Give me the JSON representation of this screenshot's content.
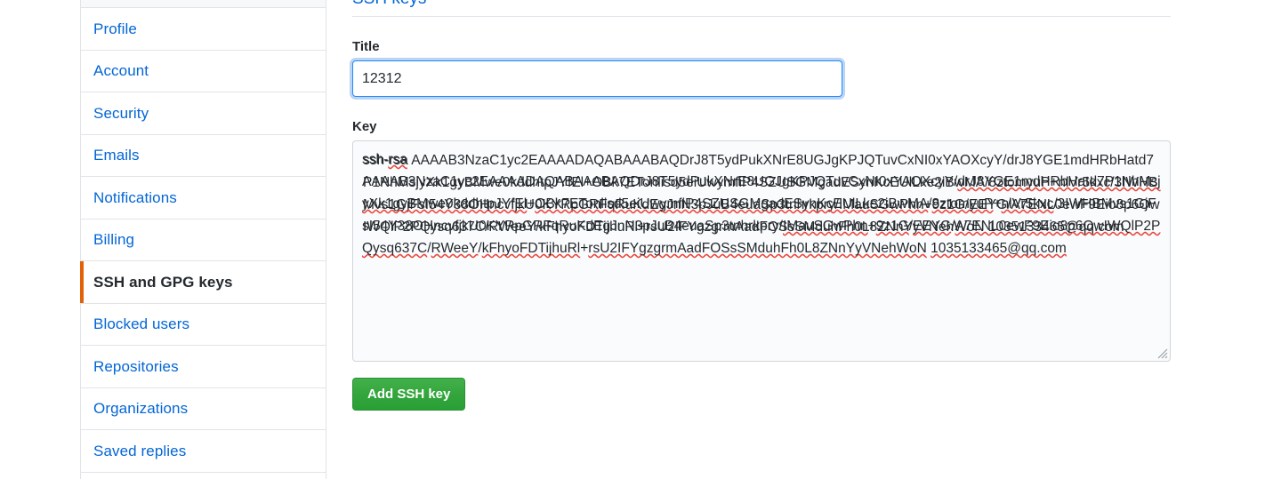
{
  "sidebar": {
    "items": [
      {
        "label": "Profile",
        "name": "profile",
        "selected": false
      },
      {
        "label": "Account",
        "name": "account",
        "selected": false
      },
      {
        "label": "Security",
        "name": "security",
        "selected": false
      },
      {
        "label": "Emails",
        "name": "emails",
        "selected": false
      },
      {
        "label": "Notifications",
        "name": "notifications",
        "selected": false
      },
      {
        "label": "Billing",
        "name": "billing",
        "selected": false
      },
      {
        "label": "SSH and GPG keys",
        "name": "ssh-and-gpg-keys",
        "selected": true
      },
      {
        "label": "Blocked users",
        "name": "blocked-users",
        "selected": false
      },
      {
        "label": "Repositories",
        "name": "repositories",
        "selected": false
      },
      {
        "label": "Organizations",
        "name": "organizations",
        "selected": false
      },
      {
        "label": "Saved replies",
        "name": "saved-replies",
        "selected": false
      }
    ],
    "accent_color": "#e36209",
    "link_color": "#0366d6"
  },
  "main": {
    "heading": "SSH keys",
    "title_field": {
      "label": "Title",
      "value": "12312",
      "placeholder": ""
    },
    "key_field": {
      "label": "Key",
      "placeholder": "",
      "value": "ssh-rsa AAAAB3NzaC1yc2EAAAADAQABAAABAQDrJ8T5ydPukXNrE8UGJgKPJQTuvCxNI0xYAOXcyY/drJ8YGE1mdHRbHatd7P1NhMsjyXk1gyBMwe0kddhtpJYfEl+OBk7ETonlisd5eiUwymfiP4SZUSGMgadESynKcEUlLke2iBwMA/8ztomyuP+nlVr5kxc/3IWHBMvs1GjFsI54Y38OHncvfjkU0KYRpGRFqRuKdEgJnN3pJuB4euaSp3tnhrkpry/IMauSGwPhn+9z1G/EEYG/A7ENL0ewF9Eio8p6OwIWQlP2PQysq637C/RWeeY/kFhyoFDTijhuRl+rsU2IFYgzgrmAadFOSsSMduhFh0L8ZNnYyVNehWoN 1035133465@qq.com",
      "segments": [
        {
          "text": "ssh-",
          "spell": false
        },
        {
          "text": "rsa",
          "spell": true
        },
        {
          "text": "\nAAAAB3NzaC1yc2EAAAADAQABAAABAQDrJ8T5ydPukXNrE8UGJgKPJQTuvCxNI0xYAOXcyY/",
          "spell": false
        },
        {
          "text": "drJ8YGE1mdHRbHatd7P1NhMsjyXk1gyBMwe0kddhtpJYfEl",
          "spell": true
        },
        {
          "text": "+",
          "spell": false
        },
        {
          "text": "OBk7ETonlisd5eiUwymfiP4SZUSGMgadESynKcEUlLke2iBwMA",
          "spell": true
        },
        {
          "text": "/",
          "spell": false
        },
        {
          "text": "8ztomyuP",
          "spell": true
        },
        {
          "text": "+",
          "spell": false
        },
        {
          "text": "nlVr5kxc",
          "spell": true
        },
        {
          "text": "/3IWHBMvs1GjFsI54Y38OHncvfjkU0KYRpGRFqRuKdEgJnN3pJuB4euaSp3tnhrkpry/",
          "spell": false
        },
        {
          "text": "IMauSGwPhn",
          "spell": true
        },
        {
          "text": "+",
          "spell": false
        },
        {
          "text": "9z1G",
          "spell": true
        },
        {
          "text": "/",
          "spell": false
        },
        {
          "text": "EEYG",
          "spell": true
        },
        {
          "text": "/",
          "spell": false
        },
        {
          "text": "A7ENL0ewF9Eio8p6OwIWQlP2PQysq637C",
          "spell": true
        },
        {
          "text": "/",
          "spell": false
        },
        {
          "text": "RWeeY",
          "spell": true
        },
        {
          "text": "/",
          "spell": false
        },
        {
          "text": "kFhyoFDTijhuRl",
          "spell": true
        },
        {
          "text": "+",
          "spell": false
        },
        {
          "text": "rsU2IFYgzgrmAadFOSsSMduhFh0L8ZNnYyVNehWoN",
          "spell": true
        },
        {
          "text": " ",
          "spell": false
        },
        {
          "text": "1035133465@qq.com",
          "spell": true
        }
      ]
    },
    "submit_button": {
      "label": "Add SSH key",
      "color": "#2ea44f"
    }
  }
}
